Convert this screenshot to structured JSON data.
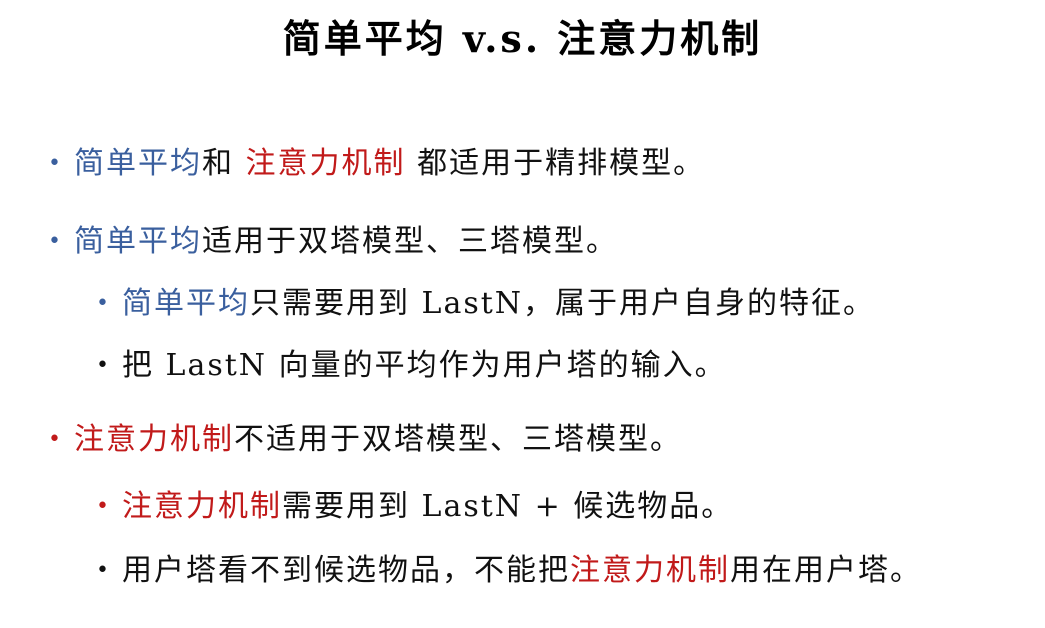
{
  "title": "简单平均 v.s. 注意力机制",
  "colors": {
    "blue": "#3a5f9e",
    "red": "#c11a1a",
    "text": "#111111"
  },
  "bullets": [
    {
      "level": 1,
      "bullet_color": "blue",
      "segments": [
        {
          "text": "简单平均",
          "color": "blue"
        },
        {
          "text": "和 ",
          "color": "dark"
        },
        {
          "text": "注意力机制",
          "color": "red"
        },
        {
          "text": " 都适用于精排模型。",
          "color": "dark"
        }
      ]
    },
    {
      "level": 1,
      "bullet_color": "blue",
      "segments": [
        {
          "text": "简单平均",
          "color": "blue"
        },
        {
          "text": "适用于双塔模型、三塔模型。",
          "color": "dark"
        }
      ]
    },
    {
      "level": 2,
      "bullet_color": "blue",
      "segments": [
        {
          "text": "简单平均",
          "color": "blue"
        },
        {
          "text": "只需要用到 LastN，属于用户自身的特征。",
          "color": "dark"
        }
      ]
    },
    {
      "level": 2,
      "bullet_color": "dark",
      "segments": [
        {
          "text": "把 LastN 向量的平均作为用户塔的输入。",
          "color": "dark"
        }
      ]
    },
    {
      "level": 1,
      "bullet_color": "red",
      "segments": [
        {
          "text": "注意力机制",
          "color": "red"
        },
        {
          "text": "不适用于双塔模型、三塔模型。",
          "color": "dark"
        }
      ]
    },
    {
      "level": 2,
      "bullet_color": "red",
      "segments": [
        {
          "text": "注意力机制",
          "color": "red"
        },
        {
          "text": "需要用到 LastN + 候选物品。",
          "color": "dark"
        }
      ]
    },
    {
      "level": 2,
      "bullet_color": "dark",
      "segments": [
        {
          "text": "用户塔看不到候选物品，不能把",
          "color": "dark"
        },
        {
          "text": "注意力机制",
          "color": "red"
        },
        {
          "text": "用在用户塔。",
          "color": "dark"
        }
      ]
    }
  ]
}
